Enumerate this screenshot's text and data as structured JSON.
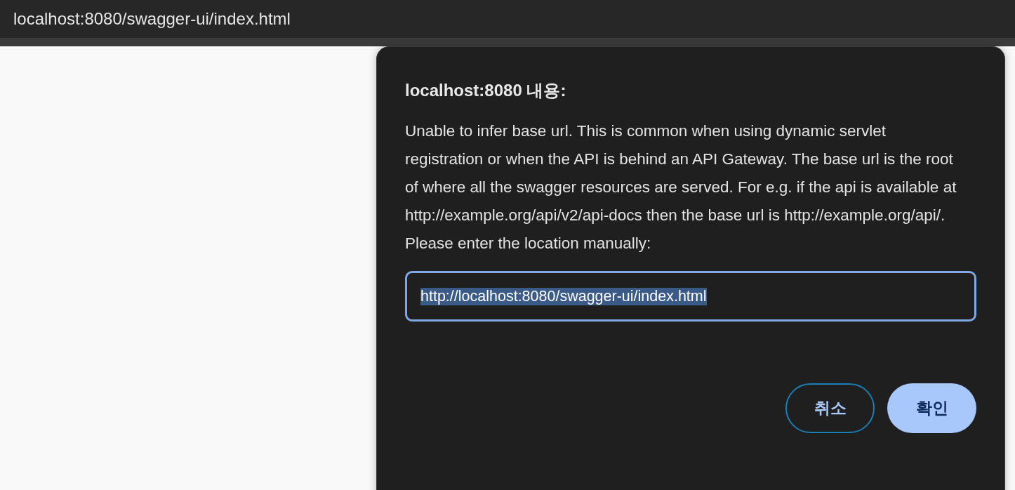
{
  "browser": {
    "address": "localhost:8080/swagger-ui/index.html"
  },
  "dialog": {
    "title": "localhost:8080 내용:",
    "message": "Unable to infer base url. This is common when using dynamic servlet registration or when the API is behind an API Gateway. The base url is the root of where all the swagger resources are served. For e.g. if the api is available at http://example.org/api/v2/api-docs then the base url is http://example.org/api/. Please enter the location manually:",
    "input": {
      "value": "http://localhost:8080/swagger-ui/index.html",
      "value_selected": true,
      "focused": true
    },
    "buttons": [
      {
        "label": "취소",
        "kind": "secondary"
      },
      {
        "label": "확인",
        "kind": "primary"
      }
    ]
  }
}
